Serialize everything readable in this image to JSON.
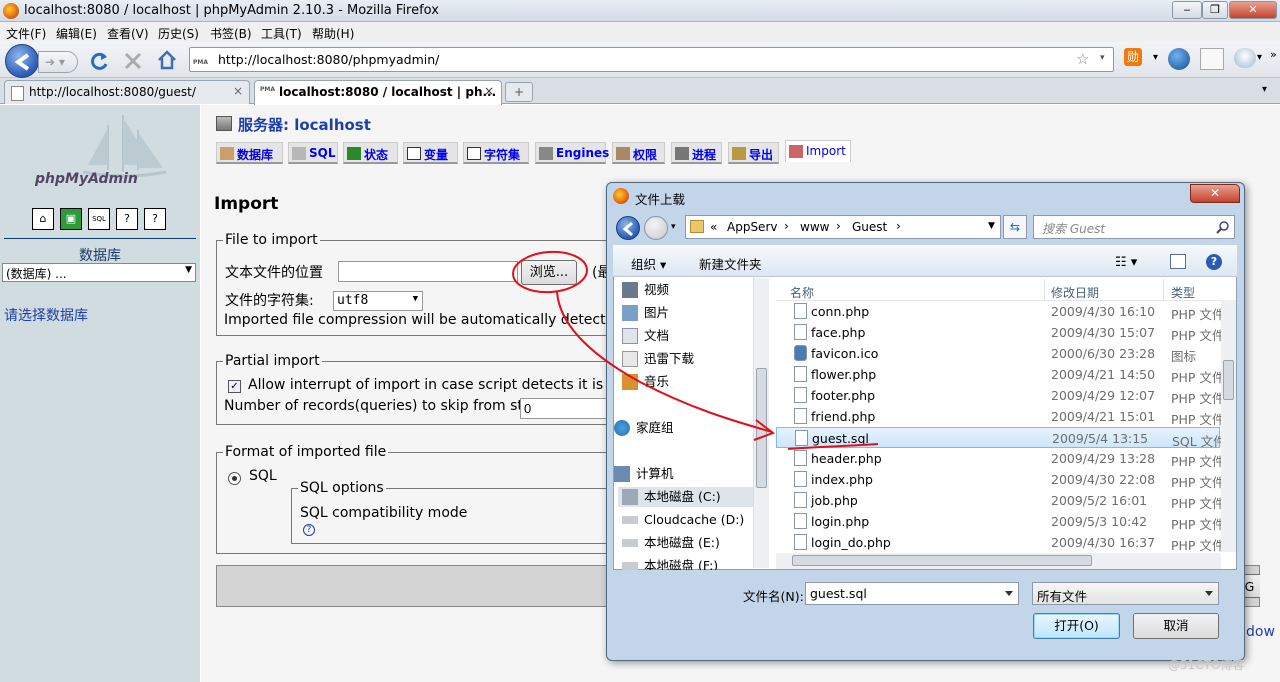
{
  "window": {
    "title": "localhost:8080 / localhost | phpMyAdmin 2.10.3 - Mozilla Firefox"
  },
  "menu": [
    "文件(F)",
    "编辑(E)",
    "查看(V)",
    "历史(S)",
    "书签(B)",
    "工具(T)",
    "帮助(H)"
  ],
  "nav": {
    "url": "http://localhost:8080/phpmyadmin/",
    "url_badge": "PMA"
  },
  "tabs": [
    {
      "label": "http://localhost:8080/guest/",
      "close": "×"
    },
    {
      "label": "localhost:8080 / localhost | ph...",
      "close": "×"
    },
    {
      "label": "+"
    }
  ],
  "left": {
    "logo": "phpMyAdmin",
    "icons": [
      "home-icon",
      "query-icon",
      "sql-icon",
      "docs-icon",
      "help-icon"
    ],
    "db_label": "数据库",
    "db_select": "(数据库) ...",
    "hint": "请选择数据库"
  },
  "main": {
    "server_label": "服务器: localhost",
    "top_tabs": [
      "数据库",
      "SQL",
      "状态",
      "变量",
      "字符集",
      "Engines",
      "权限",
      "进程",
      "导出",
      "Import"
    ],
    "title": "Import",
    "file_legend": "File to import",
    "file_location": "文本文件的位置",
    "browse": "浏览...",
    "browse_after": "(最",
    "charset_label": "文件的字符集:",
    "charset_value": "utf8",
    "compression": "Imported file compression will be automatically detected fro",
    "partial_legend": "Partial import",
    "allow_interrupt": "Allow interrupt of import in case script detects it is close",
    "skip_label": "Number of records(queries) to skip from start",
    "skip_value": "0",
    "format_legend": "Format of imported file",
    "format_sql": "SQL",
    "sql_options_legend": "SQL options",
    "compat_mode": "SQL compatibility mode",
    "go_partial": "G",
    "window_link": "dow"
  },
  "dialog": {
    "title": "文件上载",
    "breadcrumb": [
      "«",
      "AppServ",
      "www",
      "Guest"
    ],
    "search_placeholder": "搜索 Guest",
    "organize": "组织 ▾",
    "new_folder": "新建文件夹",
    "nav_items": [
      "视频",
      "图片",
      "文档",
      "迅雷下载",
      "音乐",
      "家庭组",
      "计算机",
      "本地磁盘 (C:)",
      "Cloudcache (D:)",
      "本地磁盘 (E:)",
      "本地磁盘 (F:)"
    ],
    "columns": {
      "name": "名称",
      "date": "修改日期",
      "type": "类型"
    },
    "files": [
      {
        "name": "conn.php",
        "date": "2009/4/30 16:10",
        "type": "PHP 文件"
      },
      {
        "name": "face.php",
        "date": "2009/4/30 15:07",
        "type": "PHP 文件"
      },
      {
        "name": "favicon.ico",
        "date": "2000/6/30 23:28",
        "type": "图标"
      },
      {
        "name": "flower.php",
        "date": "2009/4/21 14:50",
        "type": "PHP 文件"
      },
      {
        "name": "footer.php",
        "date": "2009/4/29 12:07",
        "type": "PHP 文件"
      },
      {
        "name": "friend.php",
        "date": "2009/4/21 15:01",
        "type": "PHP 文件"
      },
      {
        "name": "guest.sql",
        "date": "2009/5/4 13:15",
        "type": "SQL 文件"
      },
      {
        "name": "header.php",
        "date": "2009/4/29 13:28",
        "type": "PHP 文件"
      },
      {
        "name": "index.php",
        "date": "2009/4/30 22:08",
        "type": "PHP 文件"
      },
      {
        "name": "job.php",
        "date": "2009/5/2 16:01",
        "type": "PHP 文件"
      },
      {
        "name": "login.php",
        "date": "2009/5/3 10:42",
        "type": "PHP 文件"
      },
      {
        "name": "login_do.php",
        "date": "2009/4/30 16:37",
        "type": "PHP 文件"
      }
    ],
    "filename_label": "文件名(N):",
    "filename_value": "guest.sql",
    "filter_value": "所有文件",
    "open_button": "打开(O)",
    "cancel_button": "取消"
  },
  "watermark": "@51CTO博客",
  "colors": {
    "annotation": "#e0101a",
    "link": "#0000ee",
    "left_frame": "#d0dce0"
  }
}
